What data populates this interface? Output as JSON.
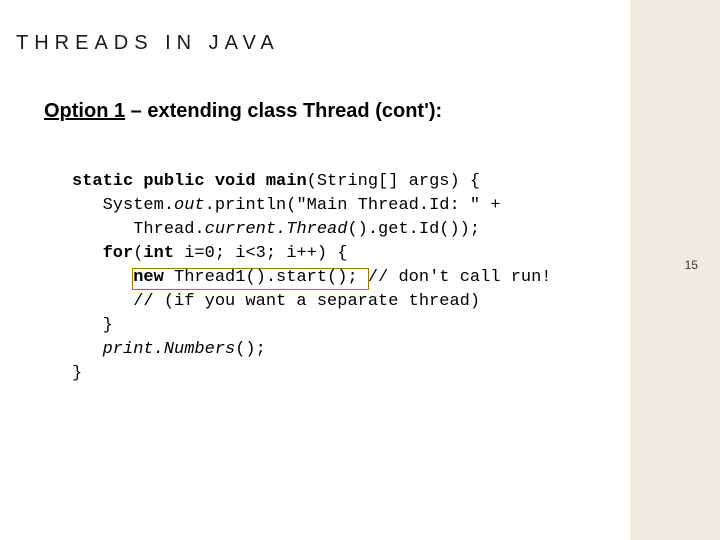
{
  "header": {
    "title": "THREADS IN JAVA"
  },
  "subhead": {
    "option_label": "Option 1",
    "rest": " – extending class Thread (cont'):"
  },
  "code": {
    "l1_pre": "static public void ",
    "l1_main": "main",
    "l1_post": "(String[] args) {",
    "l2_pre": "   System.",
    "l2_out": "out",
    "l2_post": ".println(\"Main Thread.Id: \" +",
    "l3_pre": "      Thread.",
    "l3_ct": "current.Thread",
    "l3_post": "().get.Id());",
    "l4_pre": "   ",
    "l4_for": "for",
    "l4_post1": "(",
    "l4_int": "int",
    "l4_post2": " i=0; i<3; i++) {",
    "l5_pre": "      ",
    "l5_new": "new",
    "l5_mid": " Thread1().start();",
    "l5_comment": " // don't call run!",
    "l6": "      // (if you want a separate thread)",
    "l7": "   }",
    "l8_pre": "   ",
    "l8_pn": "print.Numbers",
    "l8_post": "();",
    "l9": "}"
  },
  "page": {
    "number": "15"
  }
}
